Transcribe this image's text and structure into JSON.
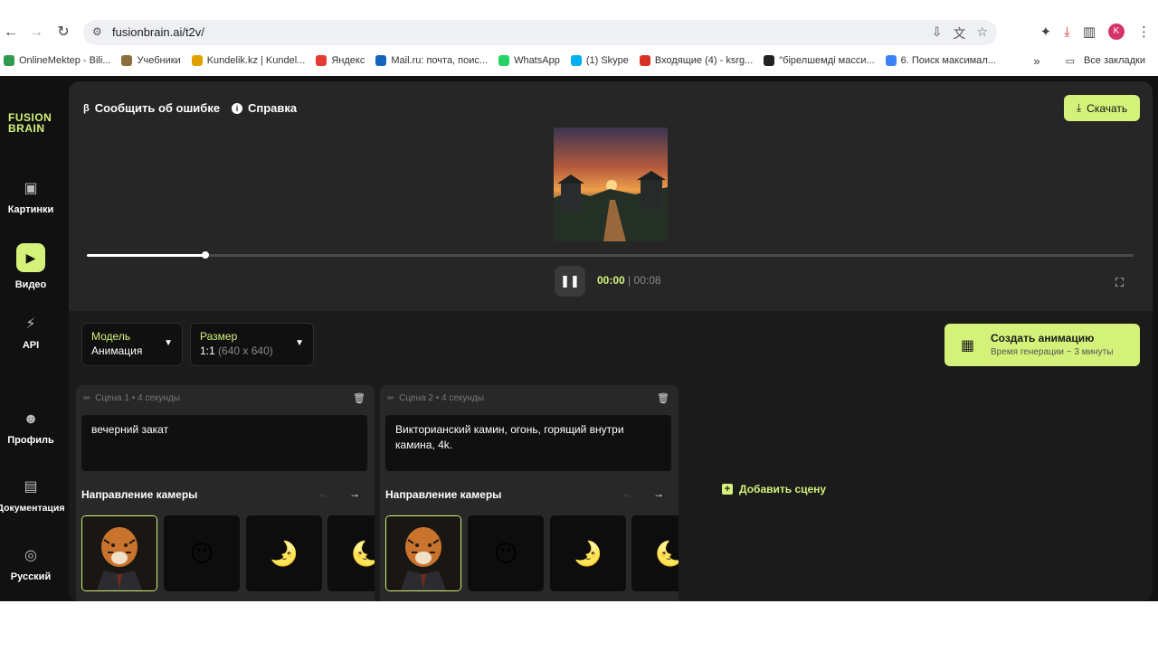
{
  "browser": {
    "url": "fusionbrain.ai/t2v/",
    "avatar_letter": "K",
    "bookmarks": [
      {
        "label": "OnlineMektep - Bili...",
        "color": "#2e9b4e"
      },
      {
        "label": "Учебники",
        "color": "#8a6d3b"
      },
      {
        "label": "Kundelik.kz | Kundel...",
        "color": "#e0a100"
      },
      {
        "label": "Яндекс",
        "color": "#e53935"
      },
      {
        "label": "Mail.ru: почта, поис...",
        "color": "#1565c0"
      },
      {
        "label": "WhatsApp",
        "color": "#25d366"
      },
      {
        "label": "(1) Skype",
        "color": "#00aff0"
      },
      {
        "label": "Входящие (4) - ksrg...",
        "color": "#d93025"
      },
      {
        "label": "\"бірелшемді масси...",
        "color": "#222222"
      },
      {
        "label": "6. Поиск максимал...",
        "color": "#3b82f6"
      }
    ],
    "more": "»",
    "all_bookmarks": "Все закладки"
  },
  "sidebar": {
    "logo_line1": "FUSION",
    "logo_line2": "BRAIN",
    "items": [
      {
        "label": "Картинки",
        "icon": "image-icon"
      },
      {
        "label": "Видео",
        "icon": "video-icon"
      },
      {
        "label": "API",
        "icon": "plug-icon"
      },
      {
        "label": "Профиль",
        "icon": "profile-icon"
      },
      {
        "label": "Документация",
        "icon": "document-icon"
      },
      {
        "label": "Русский",
        "icon": "globe-icon"
      }
    ]
  },
  "player": {
    "report_label": "Сообщить об ошибке",
    "help_label": "Справка",
    "download_label": "Скачать",
    "current_time": "00:00",
    "separator": "|",
    "duration": "00:08",
    "progress": 0.113
  },
  "controls": {
    "model_label": "Модель",
    "model_value": "Анимация",
    "size_label": "Размер",
    "size_value": "1:1",
    "size_detail": "(640 x 640)",
    "create_label": "Создать анимацию",
    "create_sub": "Время генерации ~ 3 минуты"
  },
  "scenes": [
    {
      "title": "Сцена 1 • 4 секунды",
      "prompt": "вечерний закат",
      "camera_title": "Направление камеры"
    },
    {
      "title": "Сцена 2 • 4 секунды",
      "prompt": "Викторианский камин, огонь, горящий внутри камина, 4k.",
      "camera_title": "Направление камеры"
    }
  ],
  "add_scene_label": "Добавить сцену",
  "colors": {
    "accent": "#d4f27a",
    "panel": "#1b1b1b",
    "background": "#111111"
  }
}
